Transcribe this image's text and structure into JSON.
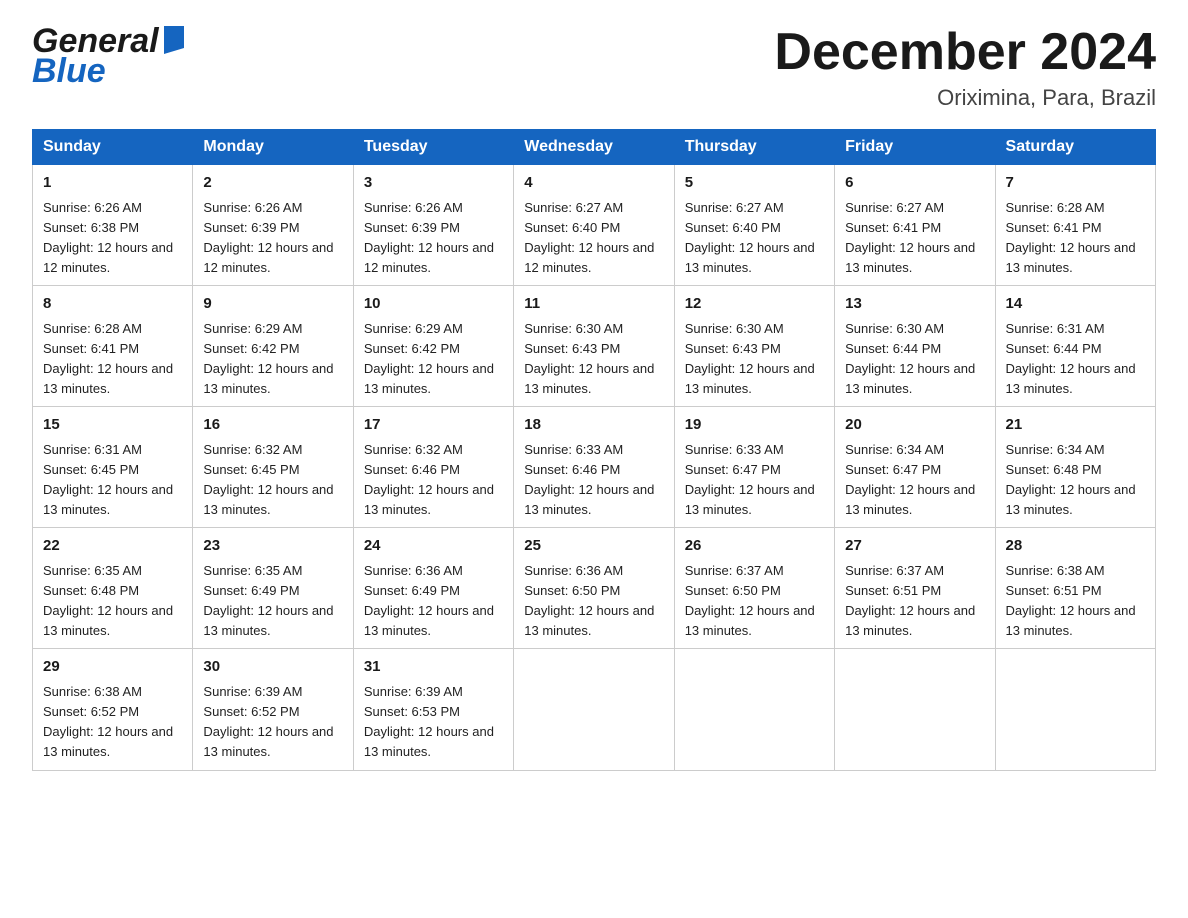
{
  "header": {
    "logo_general": "General",
    "logo_blue": "Blue",
    "month_title": "December 2024",
    "location": "Oriximina, Para, Brazil"
  },
  "weekdays": [
    "Sunday",
    "Monday",
    "Tuesday",
    "Wednesday",
    "Thursday",
    "Friday",
    "Saturday"
  ],
  "weeks": [
    [
      {
        "day": "1",
        "sunrise": "6:26 AM",
        "sunset": "6:38 PM",
        "daylight": "12 hours and 12 minutes."
      },
      {
        "day": "2",
        "sunrise": "6:26 AM",
        "sunset": "6:39 PM",
        "daylight": "12 hours and 12 minutes."
      },
      {
        "day": "3",
        "sunrise": "6:26 AM",
        "sunset": "6:39 PM",
        "daylight": "12 hours and 12 minutes."
      },
      {
        "day": "4",
        "sunrise": "6:27 AM",
        "sunset": "6:40 PM",
        "daylight": "12 hours and 12 minutes."
      },
      {
        "day": "5",
        "sunrise": "6:27 AM",
        "sunset": "6:40 PM",
        "daylight": "12 hours and 13 minutes."
      },
      {
        "day": "6",
        "sunrise": "6:27 AM",
        "sunset": "6:41 PM",
        "daylight": "12 hours and 13 minutes."
      },
      {
        "day": "7",
        "sunrise": "6:28 AM",
        "sunset": "6:41 PM",
        "daylight": "12 hours and 13 minutes."
      }
    ],
    [
      {
        "day": "8",
        "sunrise": "6:28 AM",
        "sunset": "6:41 PM",
        "daylight": "12 hours and 13 minutes."
      },
      {
        "day": "9",
        "sunrise": "6:29 AM",
        "sunset": "6:42 PM",
        "daylight": "12 hours and 13 minutes."
      },
      {
        "day": "10",
        "sunrise": "6:29 AM",
        "sunset": "6:42 PM",
        "daylight": "12 hours and 13 minutes."
      },
      {
        "day": "11",
        "sunrise": "6:30 AM",
        "sunset": "6:43 PM",
        "daylight": "12 hours and 13 minutes."
      },
      {
        "day": "12",
        "sunrise": "6:30 AM",
        "sunset": "6:43 PM",
        "daylight": "12 hours and 13 minutes."
      },
      {
        "day": "13",
        "sunrise": "6:30 AM",
        "sunset": "6:44 PM",
        "daylight": "12 hours and 13 minutes."
      },
      {
        "day": "14",
        "sunrise": "6:31 AM",
        "sunset": "6:44 PM",
        "daylight": "12 hours and 13 minutes."
      }
    ],
    [
      {
        "day": "15",
        "sunrise": "6:31 AM",
        "sunset": "6:45 PM",
        "daylight": "12 hours and 13 minutes."
      },
      {
        "day": "16",
        "sunrise": "6:32 AM",
        "sunset": "6:45 PM",
        "daylight": "12 hours and 13 minutes."
      },
      {
        "day": "17",
        "sunrise": "6:32 AM",
        "sunset": "6:46 PM",
        "daylight": "12 hours and 13 minutes."
      },
      {
        "day": "18",
        "sunrise": "6:33 AM",
        "sunset": "6:46 PM",
        "daylight": "12 hours and 13 minutes."
      },
      {
        "day": "19",
        "sunrise": "6:33 AM",
        "sunset": "6:47 PM",
        "daylight": "12 hours and 13 minutes."
      },
      {
        "day": "20",
        "sunrise": "6:34 AM",
        "sunset": "6:47 PM",
        "daylight": "12 hours and 13 minutes."
      },
      {
        "day": "21",
        "sunrise": "6:34 AM",
        "sunset": "6:48 PM",
        "daylight": "12 hours and 13 minutes."
      }
    ],
    [
      {
        "day": "22",
        "sunrise": "6:35 AM",
        "sunset": "6:48 PM",
        "daylight": "12 hours and 13 minutes."
      },
      {
        "day": "23",
        "sunrise": "6:35 AM",
        "sunset": "6:49 PM",
        "daylight": "12 hours and 13 minutes."
      },
      {
        "day": "24",
        "sunrise": "6:36 AM",
        "sunset": "6:49 PM",
        "daylight": "12 hours and 13 minutes."
      },
      {
        "day": "25",
        "sunrise": "6:36 AM",
        "sunset": "6:50 PM",
        "daylight": "12 hours and 13 minutes."
      },
      {
        "day": "26",
        "sunrise": "6:37 AM",
        "sunset": "6:50 PM",
        "daylight": "12 hours and 13 minutes."
      },
      {
        "day": "27",
        "sunrise": "6:37 AM",
        "sunset": "6:51 PM",
        "daylight": "12 hours and 13 minutes."
      },
      {
        "day": "28",
        "sunrise": "6:38 AM",
        "sunset": "6:51 PM",
        "daylight": "12 hours and 13 minutes."
      }
    ],
    [
      {
        "day": "29",
        "sunrise": "6:38 AM",
        "sunset": "6:52 PM",
        "daylight": "12 hours and 13 minutes."
      },
      {
        "day": "30",
        "sunrise": "6:39 AM",
        "sunset": "6:52 PM",
        "daylight": "12 hours and 13 minutes."
      },
      {
        "day": "31",
        "sunrise": "6:39 AM",
        "sunset": "6:53 PM",
        "daylight": "12 hours and 13 minutes."
      },
      null,
      null,
      null,
      null
    ]
  ],
  "day_labels": {
    "sunrise_prefix": "Sunrise: ",
    "sunset_prefix": "Sunset: ",
    "daylight_prefix": "Daylight: "
  }
}
